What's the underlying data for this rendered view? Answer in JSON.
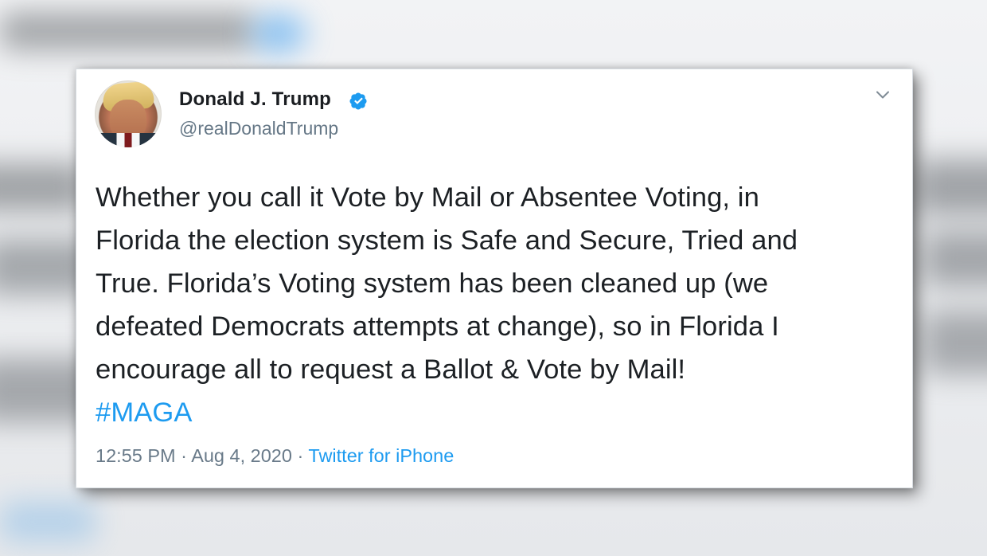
{
  "tweet": {
    "author_name": "Donald J. Trump",
    "handle": "@realDonaldTrump",
    "verified_icon": "verified-badge-icon",
    "menu_icon": "chevron-down-icon",
    "text_lines": [
      "Whether you call it Vote by Mail or Absentee Voting, in",
      "Florida the election system is Safe and Secure, Tried and",
      "True. Florida’s Voting system has been cleaned up (we",
      "defeated Democrats attempts at change), so in Florida I",
      "encourage all to request a Ballot & Vote by Mail!"
    ],
    "hashtag": "#MAGA",
    "time": "12:55 PM",
    "separator": " · ",
    "date": "Aug 4, 2020",
    "source": "Twitter for iPhone"
  },
  "colors": {
    "accent": "#1d9bf0",
    "text": "#1c2024",
    "muted": "#697a89"
  }
}
